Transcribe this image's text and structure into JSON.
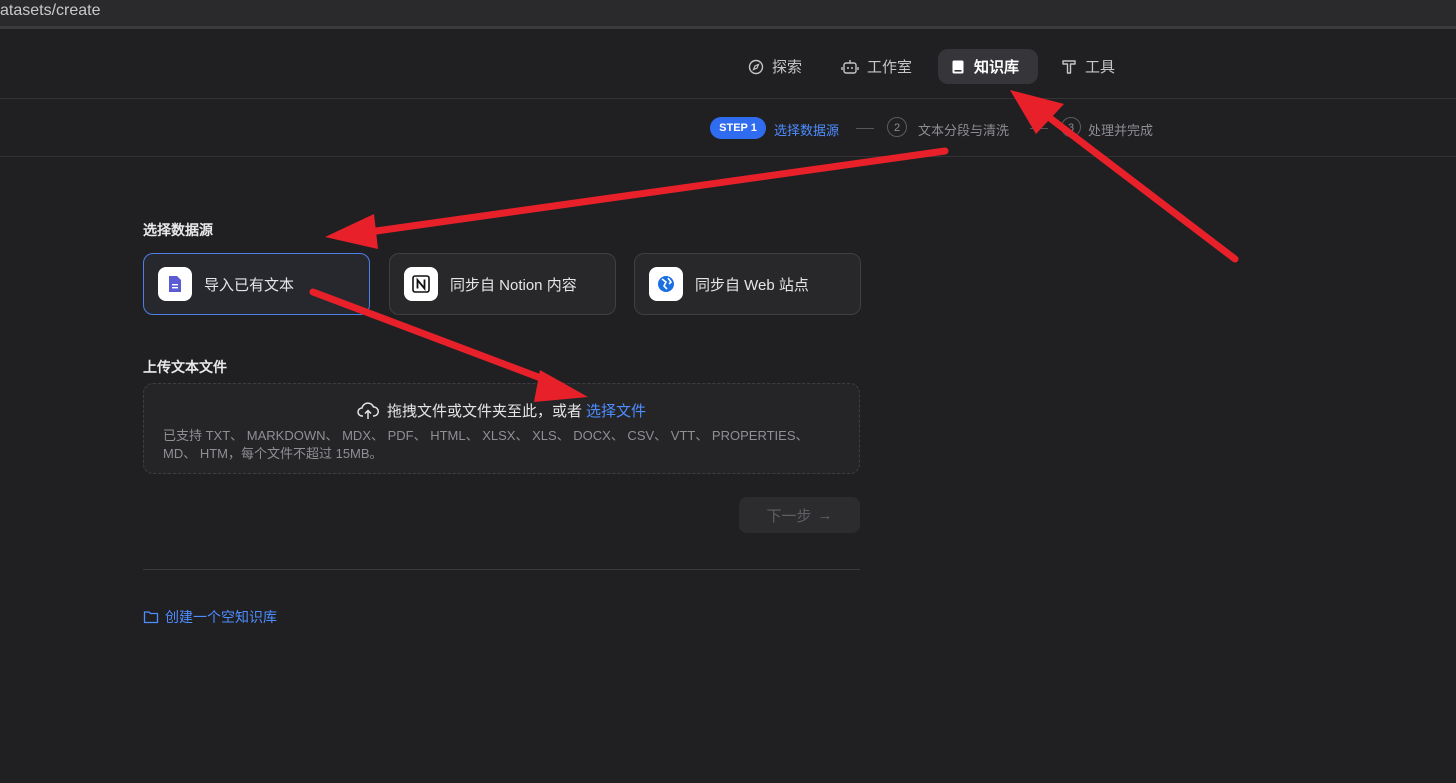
{
  "browser": {
    "url_fragment": "atasets/create"
  },
  "nav": {
    "items": [
      {
        "label": "探索",
        "icon": "compass-icon"
      },
      {
        "label": "工作室",
        "icon": "robot-icon"
      },
      {
        "label": "知识库",
        "icon": "book-icon",
        "active": true
      },
      {
        "label": "工具",
        "icon": "tool-icon"
      }
    ]
  },
  "steps": {
    "step1_badge": "STEP 1",
    "step1_label": "选择数据源",
    "step2_num": "2",
    "step2_label": "文本分段与清洗",
    "step3_num": "3",
    "step3_label": "处理并完成"
  },
  "datasource": {
    "title": "选择数据源",
    "options": [
      {
        "label": "导入已有文本",
        "icon": "document-icon",
        "selected": true
      },
      {
        "label": "同步自 Notion 内容",
        "icon": "notion-icon"
      },
      {
        "label": "同步自 Web 站点",
        "icon": "web-icon"
      }
    ]
  },
  "upload": {
    "title": "上传文本文件",
    "drop_text": "拖拽文件或文件夹至此，或者",
    "choose_link": "选择文件",
    "hint": "已支持 TXT、 MARKDOWN、 MDX、 PDF、 HTML、 XLSX、 XLS、 DOCX、 CSV、 VTT、 PROPERTIES、 MD、 HTM，每个文件不超过 15MB。"
  },
  "next_button": {
    "label": "下一步",
    "enabled": false
  },
  "create_empty": {
    "label": "创建一个空知识库"
  },
  "colors": {
    "accent": "#4d8dff",
    "background": "#202023",
    "annotation_arrow": "#e8202a"
  }
}
